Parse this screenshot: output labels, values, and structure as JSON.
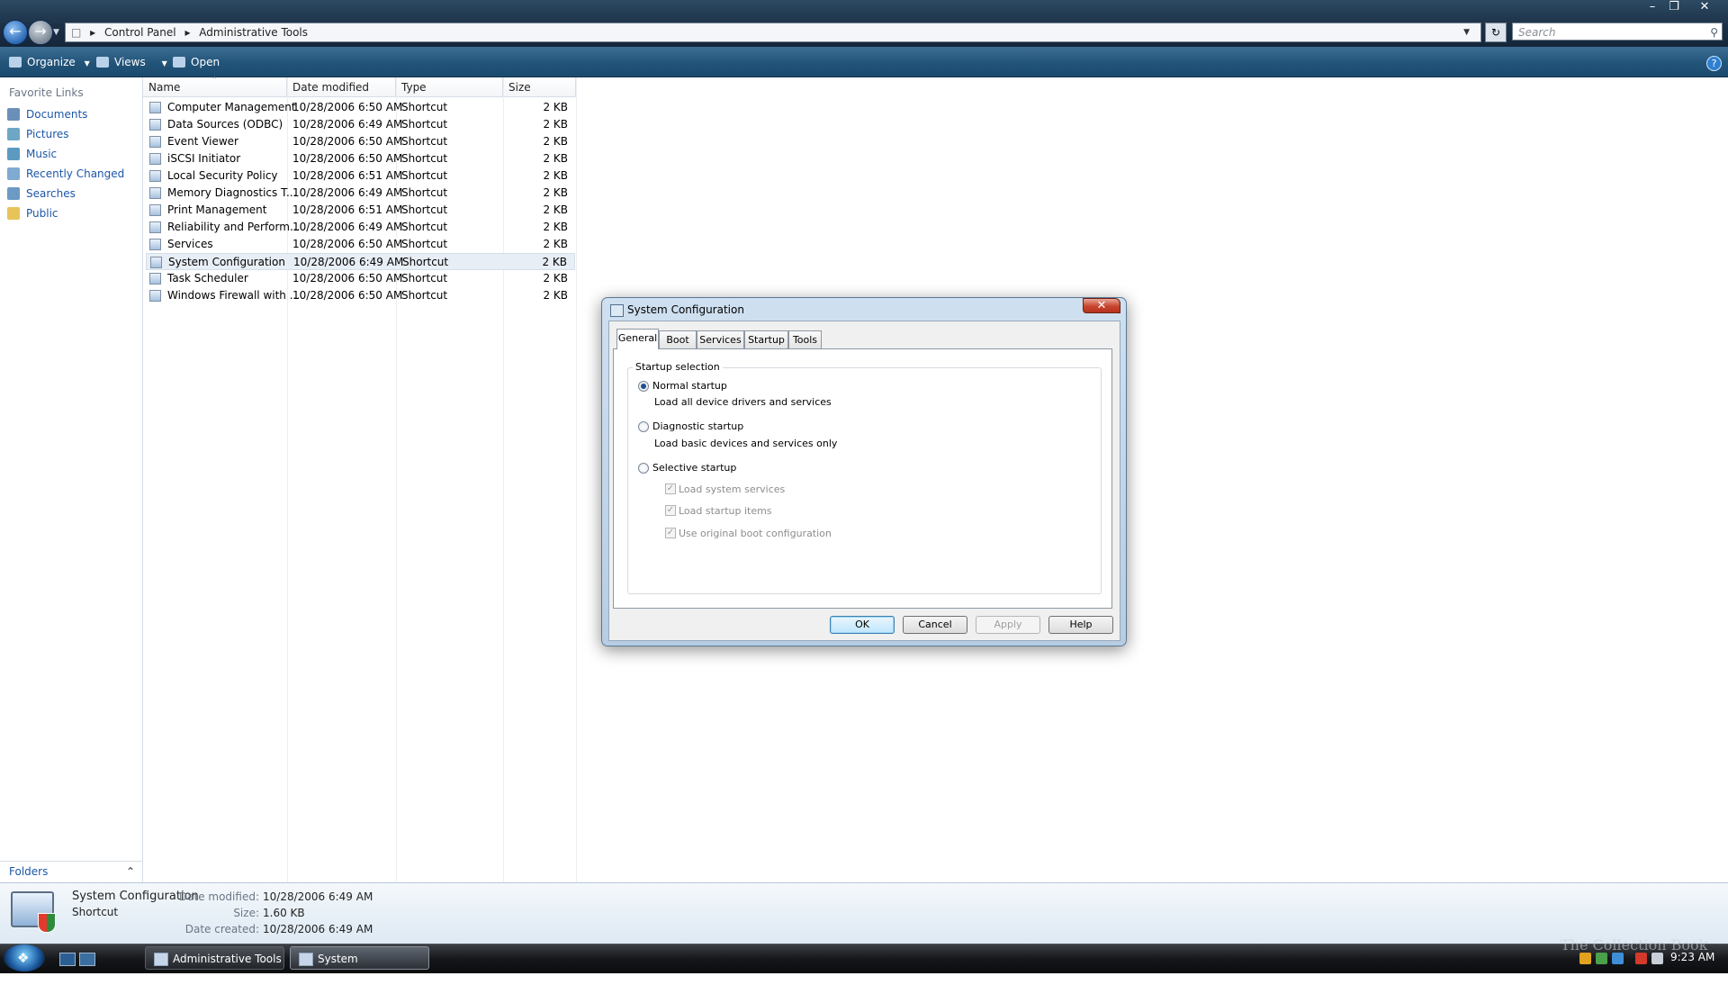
{
  "window": {
    "address": [
      "Control Panel",
      "Administrative Tools"
    ],
    "search_placeholder": "Search",
    "controls": {
      "minimize": "–",
      "maximize": "❐",
      "close": "✕"
    }
  },
  "toolbar": {
    "organize": "Organize",
    "views": "Views",
    "open": "Open",
    "help": "?"
  },
  "favorites": {
    "title": "Favorite Links",
    "items": [
      "Documents",
      "Pictures",
      "Music",
      "Recently Changed",
      "Searches",
      "Public"
    ],
    "folders_label": "Folders"
  },
  "columns": [
    "Name",
    "Date modified",
    "Type",
    "Size"
  ],
  "files": [
    {
      "name": "Computer Management",
      "date": "10/28/2006 6:50 AM",
      "type": "Shortcut",
      "size": "2 KB"
    },
    {
      "name": "Data Sources (ODBC)",
      "date": "10/28/2006 6:49 AM",
      "type": "Shortcut",
      "size": "2 KB"
    },
    {
      "name": "Event Viewer",
      "date": "10/28/2006 6:50 AM",
      "type": "Shortcut",
      "size": "2 KB"
    },
    {
      "name": "iSCSI Initiator",
      "date": "10/28/2006 6:50 AM",
      "type": "Shortcut",
      "size": "2 KB"
    },
    {
      "name": "Local Security Policy",
      "date": "10/28/2006 6:51 AM",
      "type": "Shortcut",
      "size": "2 KB"
    },
    {
      "name": "Memory Diagnostics T...",
      "date": "10/28/2006 6:49 AM",
      "type": "Shortcut",
      "size": "2 KB"
    },
    {
      "name": "Print Management",
      "date": "10/28/2006 6:51 AM",
      "type": "Shortcut",
      "size": "2 KB"
    },
    {
      "name": "Reliability and Perform...",
      "date": "10/28/2006 6:49 AM",
      "type": "Shortcut",
      "size": "2 KB"
    },
    {
      "name": "Services",
      "date": "10/28/2006 6:50 AM",
      "type": "Shortcut",
      "size": "2 KB"
    },
    {
      "name": "System Configuration",
      "date": "10/28/2006 6:49 AM",
      "type": "Shortcut",
      "size": "2 KB"
    },
    {
      "name": "Task Scheduler",
      "date": "10/28/2006 6:50 AM",
      "type": "Shortcut",
      "size": "2 KB"
    },
    {
      "name": "Windows Firewall with ...",
      "date": "10/28/2006 6:50 AM",
      "type": "Shortcut",
      "size": "2 KB"
    }
  ],
  "selected_file": "System Configuration",
  "details": {
    "name": "System Configuration",
    "kind": "Shortcut",
    "date_modified_label": "Date modified:",
    "date_modified": "10/28/2006 6:49 AM",
    "size_label": "Size:",
    "size": "1.60 KB",
    "date_created_label": "Date created:",
    "date_created": "10/28/2006 6:49 AM"
  },
  "dialog": {
    "title": "System Configuration",
    "close": "✕",
    "tabs": [
      "General",
      "Boot",
      "Services",
      "Startup",
      "Tools"
    ],
    "active_tab": "General",
    "group_label": "Startup selection",
    "normal": {
      "label": "Normal startup",
      "desc": "Load all device drivers and services",
      "selected": true
    },
    "diagnostic": {
      "label": "Diagnostic startup",
      "desc": "Load basic devices and services only",
      "selected": false
    },
    "selective": {
      "label": "Selective startup",
      "selected": false,
      "options": [
        {
          "label": "Load system services",
          "checked": true,
          "disabled": true
        },
        {
          "label": "Load startup items",
          "checked": true,
          "disabled": true
        },
        {
          "label": "Use original boot configuration",
          "checked": true,
          "disabled": true
        }
      ]
    },
    "buttons": {
      "ok": "OK",
      "cancel": "Cancel",
      "apply": "Apply",
      "help": "Help"
    }
  },
  "taskbar": {
    "buttons": [
      "Administrative Tools",
      "System Configuration"
    ],
    "active": "System Configuration",
    "clock": "9:23 AM",
    "watermark": "The Collection Book"
  },
  "colors": {
    "accent": "#1c56a8",
    "titlebar": "#1b2f45",
    "selection": "#e8eef5"
  }
}
